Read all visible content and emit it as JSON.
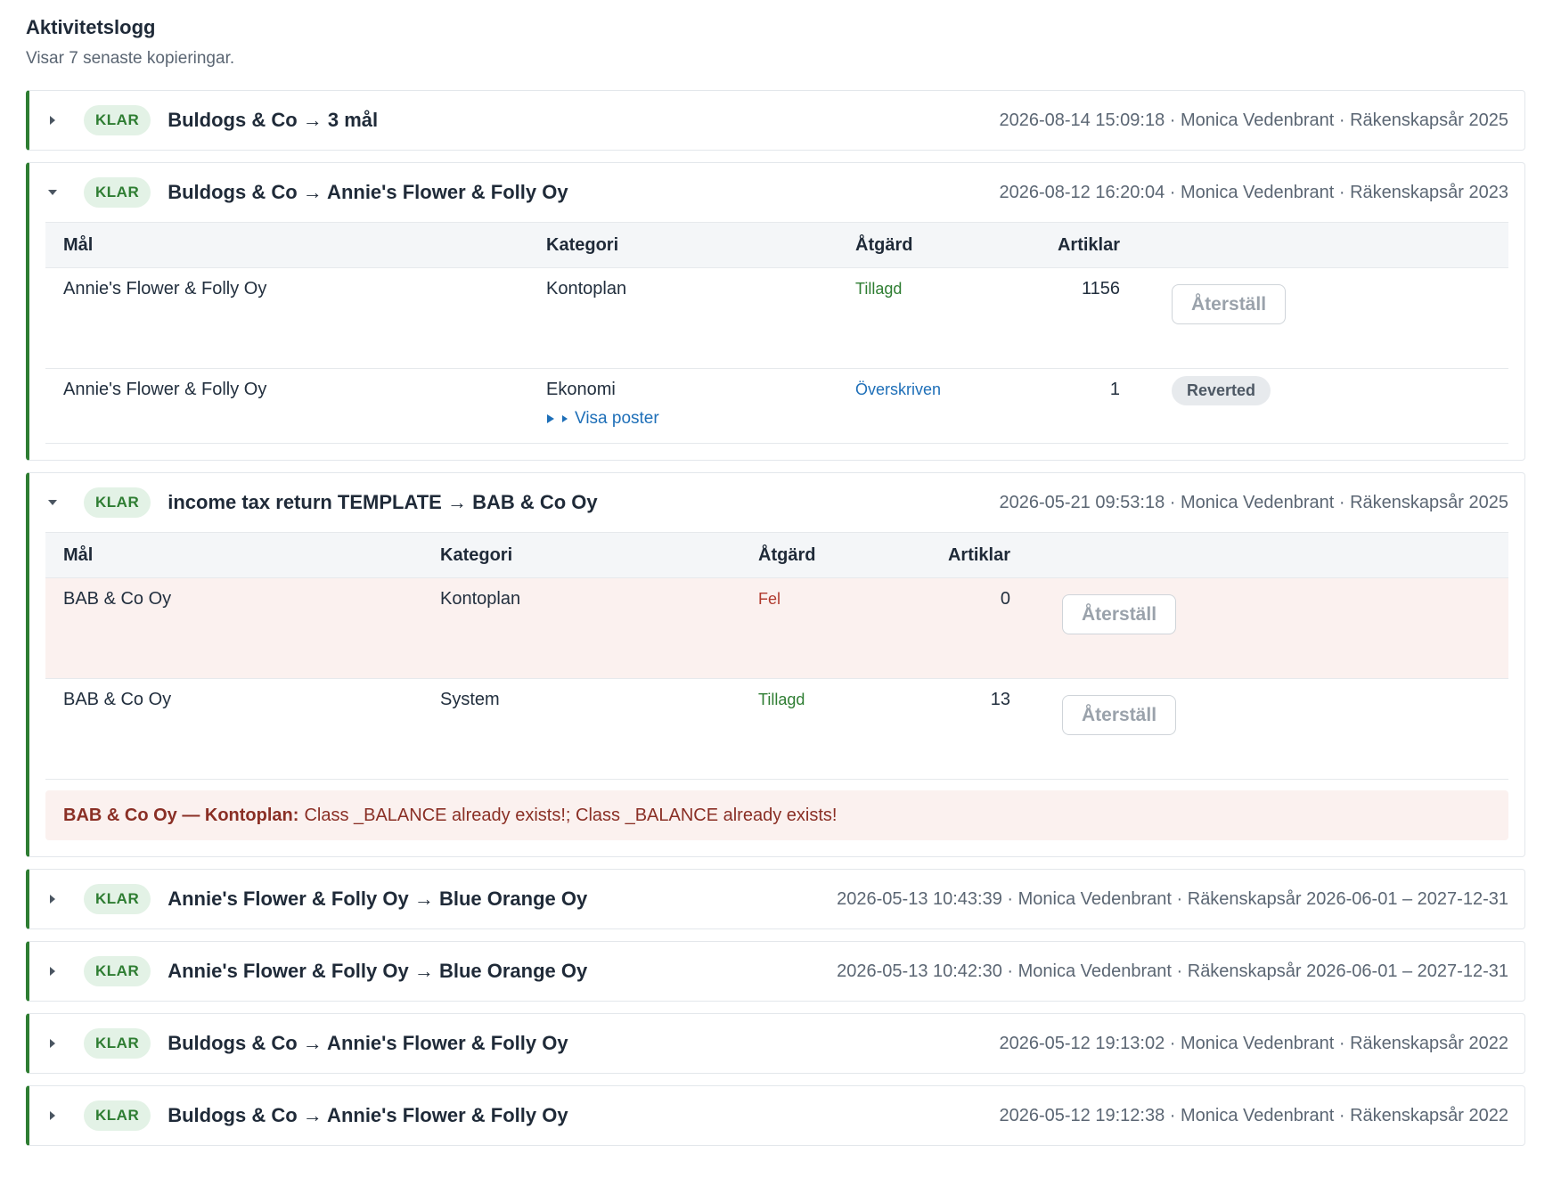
{
  "header": {
    "title": "Aktivitetslogg",
    "subtitle": "Visar 7 senaste kopieringar."
  },
  "colors": {
    "accent": "#2e7d32",
    "badge_bg": "#e3f2e6",
    "link": "#1e6fb8",
    "error": "#b03a2e"
  },
  "entries": [
    {
      "status": "KLAR",
      "title": "Buldogs & Co → 3 mål",
      "meta": "2026-08-14 15:09:18 · Monica Vedenbrant · Räkenskapsår 2025",
      "expanded": false
    },
    {
      "status": "KLAR",
      "title": "Buldogs & Co → Annie's Flower & Folly Oy",
      "meta": "2026-08-12 16:20:04 · Monica Vedenbrant · Räkenskapsår 2023",
      "expanded": true,
      "columns": [
        "Mål",
        "Kategori",
        "Åtgärd",
        "Artiklar"
      ],
      "rows": [
        {
          "target": "Annie's Flower & Folly Oy",
          "category": "Kontoplan",
          "action": "Tillagd",
          "articles": "1156",
          "control": "Återställ"
        },
        {
          "target": "Annie's Flower & Folly Oy",
          "category": "Ekonomi",
          "action": "Överskriven",
          "articles": "1",
          "control": "Reverted",
          "link": "Visa poster"
        }
      ]
    },
    {
      "status": "KLAR",
      "title": "income tax return TEMPLATE → BAB & Co Oy",
      "meta": "2026-05-21 09:53:18 · Monica Vedenbrant · Räkenskapsår 2025",
      "expanded": true,
      "columns": [
        "Mål",
        "Kategori",
        "Åtgärd",
        "Artiklar"
      ],
      "rows": [
        {
          "target": "BAB & Co Oy",
          "category": "Kontoplan",
          "action": "Fel",
          "articles": "0",
          "control": "Återställ"
        },
        {
          "target": "BAB & Co Oy",
          "category": "System",
          "action": "Tillagd",
          "articles": "13",
          "control": "Återställ"
        }
      ],
      "error": {
        "label": "BAB & Co Oy — Kontoplan:",
        "message": "Class _BALANCE already exists!; Class _BALANCE already exists!"
      }
    },
    {
      "status": "KLAR",
      "title": "Annie's Flower & Folly Oy → Blue Orange Oy",
      "meta": "2026-05-13 10:43:39 · Monica Vedenbrant · Räkenskapsår 2026-06-01 – 2027-12-31",
      "expanded": false
    },
    {
      "status": "KLAR",
      "title": "Annie's Flower & Folly Oy → Blue Orange Oy",
      "meta": "2026-05-13 10:42:30 · Monica Vedenbrant · Räkenskapsår 2026-06-01 – 2027-12-31",
      "expanded": false
    },
    {
      "status": "KLAR",
      "title": "Buldogs & Co → Annie's Flower & Folly Oy",
      "meta": "2026-05-12 19:13:02 · Monica Vedenbrant · Räkenskapsår 2022",
      "expanded": false
    },
    {
      "status": "KLAR",
      "title": "Buldogs & Co → Annie's Flower & Folly Oy",
      "meta": "2026-05-12 19:12:38 · Monica Vedenbrant · Räkenskapsår 2022",
      "expanded": false
    }
  ]
}
